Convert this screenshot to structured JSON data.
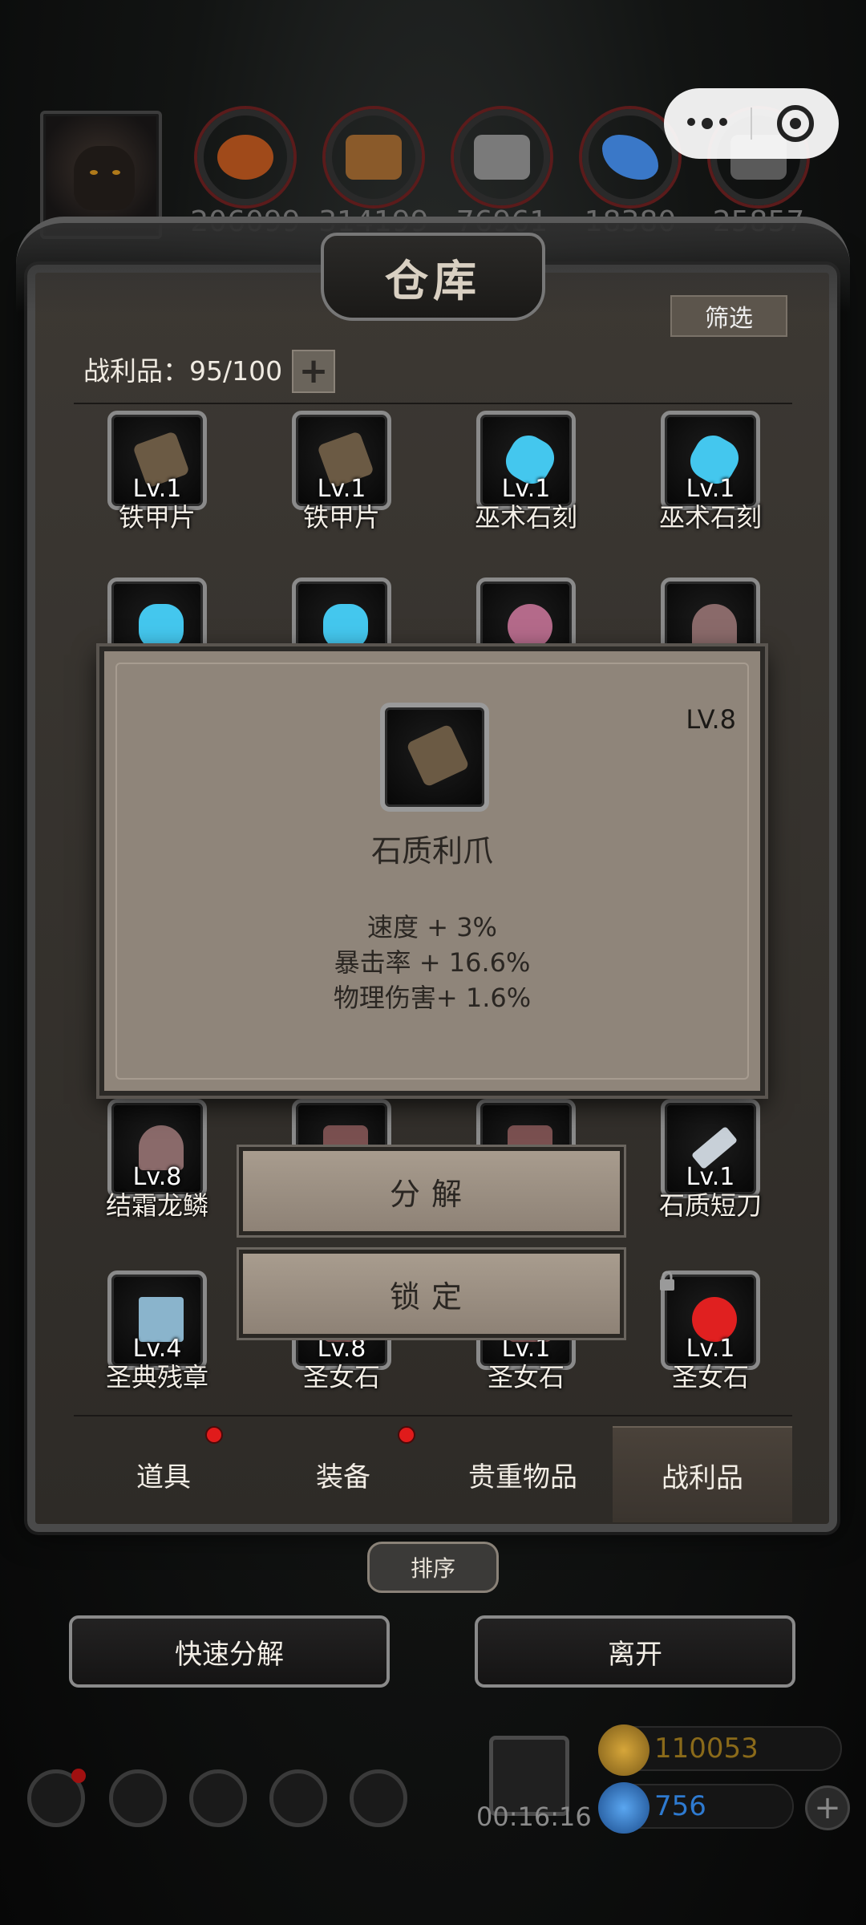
{
  "resources": [
    {
      "name": "lantern-resource-icon",
      "value": "206099",
      "color": "#a04a1a"
    },
    {
      "name": "wood-resource-icon",
      "value": "314199",
      "color": "#8a5a2a"
    },
    {
      "name": "stone-resource-icon",
      "value": "76961",
      "color": "#7a7a7a"
    },
    {
      "name": "crystal-resource-icon",
      "value": "18380",
      "color": "#3a78c8"
    },
    {
      "name": "iron-resource-icon",
      "value": "25857",
      "color": "#5a5a5a"
    }
  ],
  "warehouse": {
    "title": "仓库",
    "filter_label": "筛选",
    "loot_count": "战利品：95/100",
    "plus": "+"
  },
  "items_row1": [
    {
      "lv": "Lv.1",
      "name": "铁甲片",
      "art_color": "#6b5a44"
    },
    {
      "lv": "Lv.1",
      "name": "铁甲片",
      "art_color": "#6b5a44"
    },
    {
      "lv": "Lv.1",
      "name": "巫术石刻",
      "art_color": "#44c7ee"
    },
    {
      "lv": "Lv.1",
      "name": "巫术石刻",
      "art_color": "#44c7ee"
    }
  ],
  "items_row2_art": [
    "#44c7ee",
    "#44c7ee",
    "#b46a8a",
    "#8a6a6a"
  ],
  "items_row5": [
    {
      "lv": "Lv.8",
      "name": "结霜龙鳞",
      "art_color": "#8a6a6a"
    },
    {
      "lv": "",
      "name": "",
      "art_color": "#7a5050"
    },
    {
      "lv": "",
      "name": "",
      "art_color": "#7a5050"
    },
    {
      "lv": "Lv.1",
      "name": "石质短刀",
      "art_color": "#c8d0d8"
    }
  ],
  "items_row6": [
    {
      "lv": "Lv.4",
      "name": "圣典残章",
      "art_color": "#8ab4cc"
    },
    {
      "lv": "Lv.8",
      "name": "圣女石",
      "art_color": "#7a5050"
    },
    {
      "lv": "Lv.1",
      "name": "圣女石",
      "art_color": "#7a5050"
    },
    {
      "lv": "Lv.1",
      "name": "圣女石",
      "art_color": "#e02020"
    }
  ],
  "tabs": [
    {
      "label": "道具",
      "badge": true
    },
    {
      "label": "装备",
      "badge": true
    },
    {
      "label": "贵重物品",
      "badge": false
    },
    {
      "label": "战利品",
      "badge": false,
      "active": true
    }
  ],
  "sort_label": "排序",
  "quick_decompose_label": "快速分解",
  "leave_label": "离开",
  "timer": "00:16:16",
  "gold": "110053",
  "gems": "756",
  "modal": {
    "level": "LV.8",
    "name": "石质利爪",
    "stats": [
      "速度 + 3%",
      "暴击率 + 16.6%",
      "物理伤害+ 1.6%"
    ]
  },
  "actions": {
    "decompose": "分解",
    "lock": "锁定"
  },
  "colors": {
    "accent_red": "#e01b1b",
    "gold_text": "#8a6a1a",
    "gem_text": "#2e7ad0"
  }
}
